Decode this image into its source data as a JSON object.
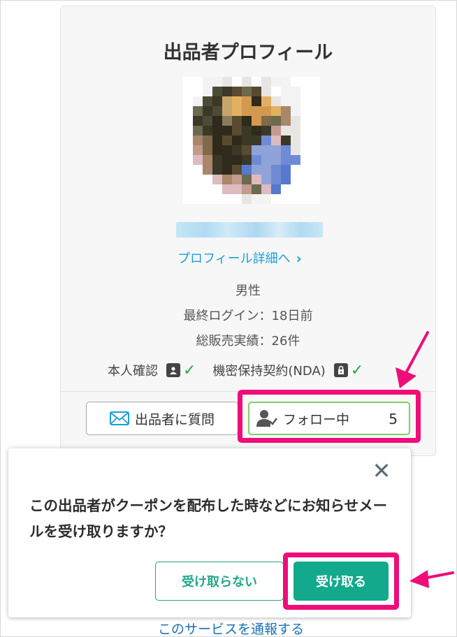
{
  "profile_card": {
    "title": "出品者プロフィール",
    "detail_link_label": "プロフィール詳細へ",
    "gender": "男性",
    "last_login": "最終ログイン：18日前",
    "sales_record": "総販売実績：26件",
    "identity_verified_label": "本人確認",
    "nda_label": "機密保持契約(NDA)",
    "ask_seller_button": "出品者に質問",
    "follow_button": "フォロー中",
    "follow_count": "5"
  },
  "modal": {
    "message": "この出品者がクーポンを配布した時などにお知らせメールを受け取りますか？",
    "decline_button": "受け取らない",
    "accept_button": "受け取る"
  },
  "footer": {
    "report_link": "このサービスを通報する"
  },
  "icons": {
    "chevron": "chevron-right-icon",
    "id_card": "id-card-icon",
    "lock": "lock-icon",
    "check": "check-icon",
    "mail": "mail-icon",
    "user_check": "user-check-icon",
    "close": "close-icon"
  },
  "colors": {
    "link_blue": "#1aa0d6",
    "accent_green": "#13a98c",
    "check_green": "#1fae3a",
    "highlight_pink": "#ee0d79"
  }
}
